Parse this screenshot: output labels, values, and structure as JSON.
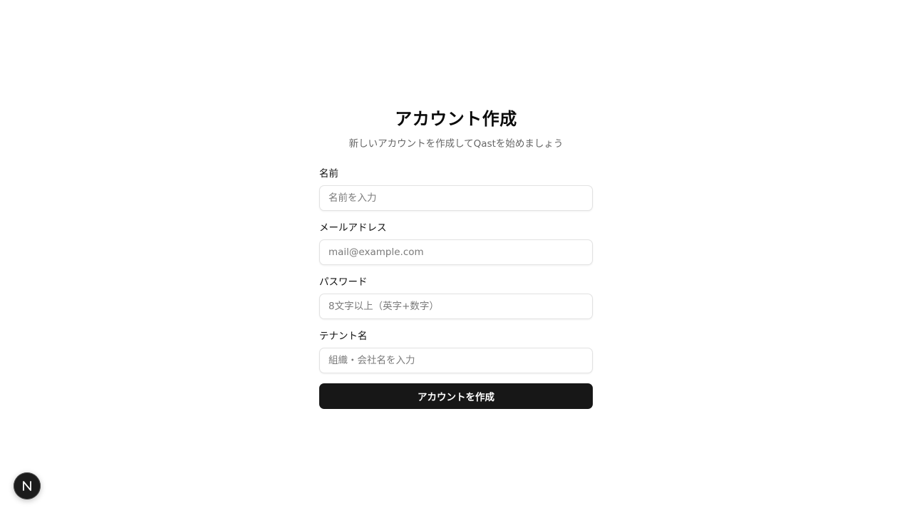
{
  "header": {
    "title": "アカウント作成",
    "subtitle": "新しいアカウントを作成してQastを始めましょう"
  },
  "form": {
    "name": {
      "label": "名前",
      "value": "",
      "placeholder": "名前を入力"
    },
    "email": {
      "label": "メールアドレス",
      "value": "",
      "placeholder": "mail@example.com"
    },
    "password": {
      "label": "パスワード",
      "value": "",
      "placeholder": "8文字以上（英字+数字）"
    },
    "tenant": {
      "label": "テナント名",
      "value": "",
      "placeholder": "組織・会社名を入力"
    },
    "submit_label": "アカウントを作成"
  },
  "dev_indicator": {
    "icon": "nextjs-logo-icon"
  },
  "colors": {
    "background": "#ffffff",
    "button_bg": "#171717",
    "button_text": "#ffffff",
    "muted_text": "#666666",
    "input_border": "#e2e2e2"
  }
}
